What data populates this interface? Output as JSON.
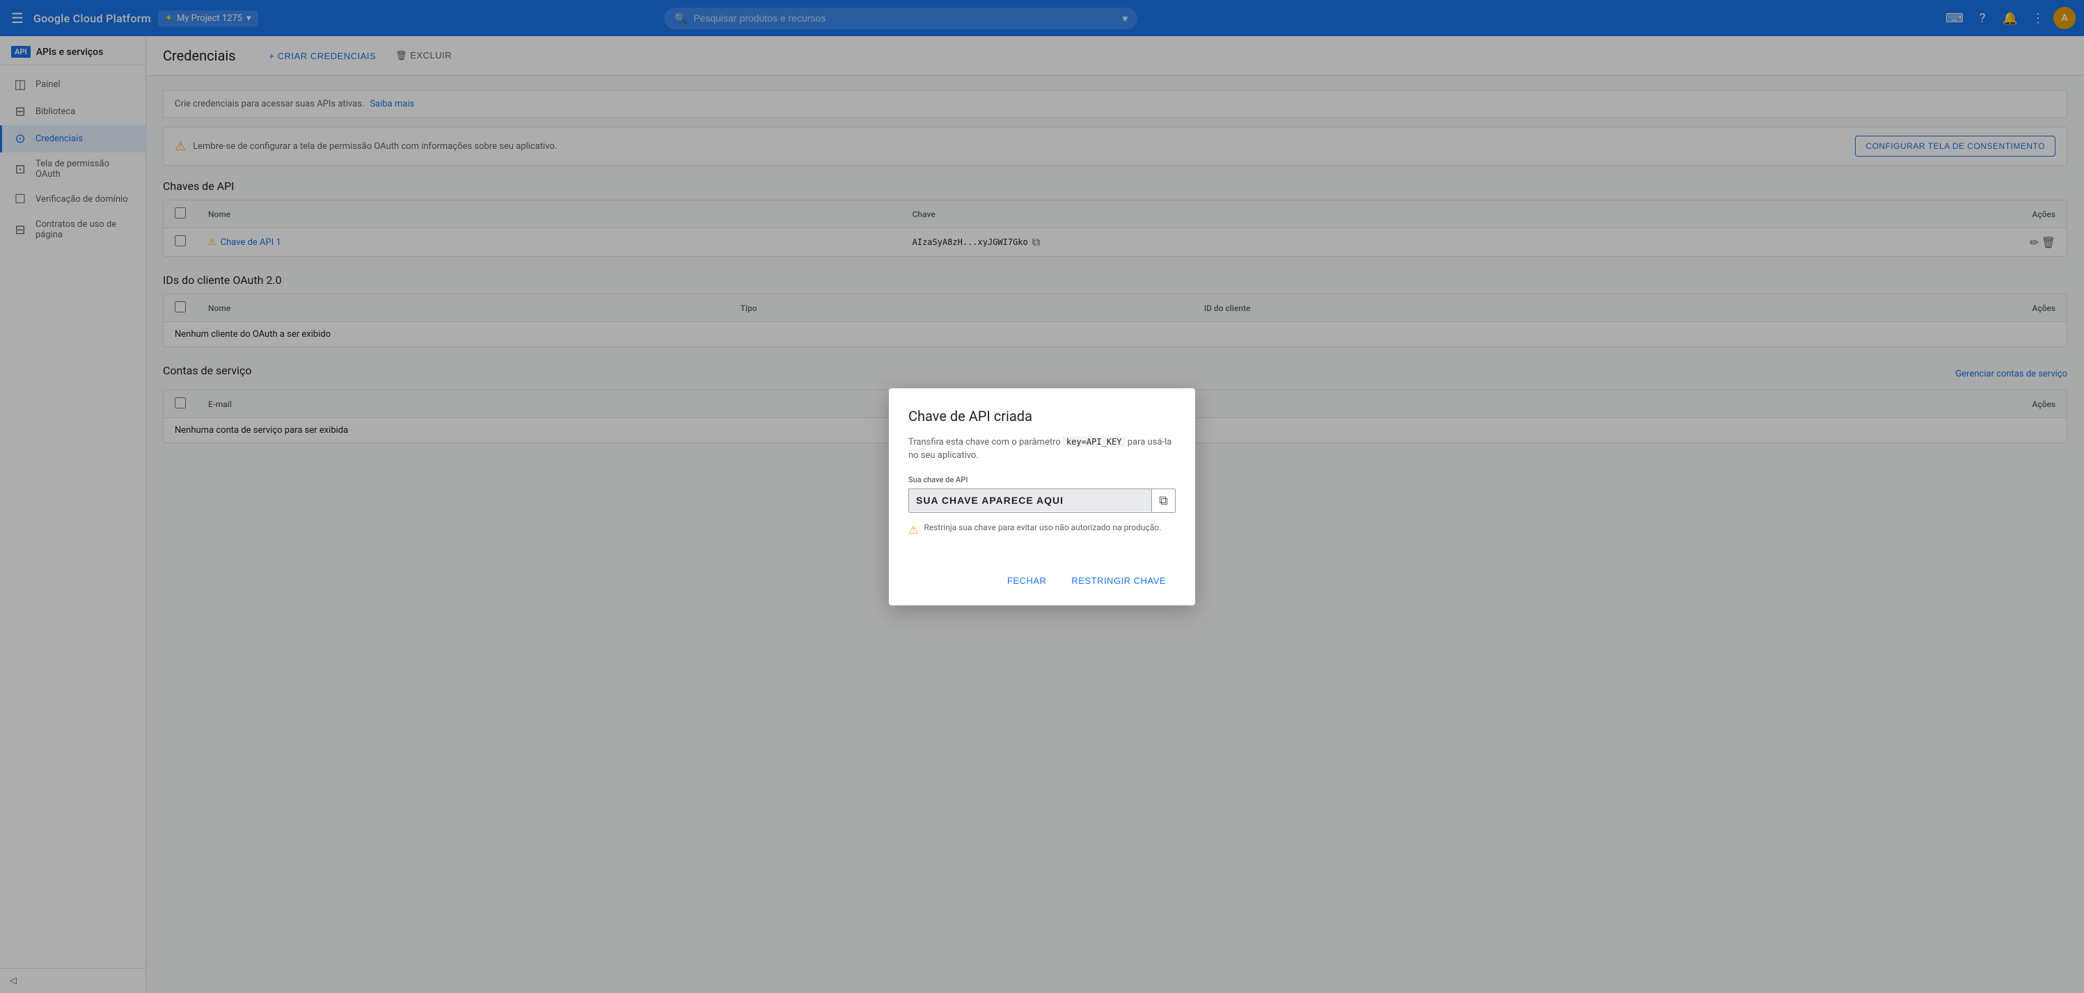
{
  "topNav": {
    "appName": "Google Cloud Platform",
    "project": "My Project 1275",
    "searchPlaceholder": "Pesquisar produtos e recursos",
    "hamburgerIcon": "☰",
    "dropdownIcon": "▾",
    "searchIconChar": "🔍",
    "icons": {
      "cloudShell": "⌨",
      "help": "?",
      "bell": "🔔",
      "dots": "⋮"
    },
    "avatarInitial": "A"
  },
  "sidebar": {
    "apiBadge": "API",
    "title": "APIs e serviços",
    "items": [
      {
        "id": "painel",
        "label": "Painel",
        "icon": "⊞",
        "active": false
      },
      {
        "id": "biblioteca",
        "label": "Biblioteca",
        "icon": "⊟",
        "active": false
      },
      {
        "id": "credenciais",
        "label": "Credenciais",
        "icon": "⊙",
        "active": true
      },
      {
        "id": "tela-permissao",
        "label": "Tela de permissão OAuth",
        "icon": "⊡",
        "active": false
      },
      {
        "id": "verificacao-dominio",
        "label": "Verificação de domínio",
        "icon": "☰",
        "active": false
      },
      {
        "id": "contratos-uso",
        "label": "Contratos de uso de página",
        "icon": "⊟",
        "active": false
      }
    ],
    "collapseIcon": "◁"
  },
  "page": {
    "title": "Credenciais",
    "createBtn": "+ CRIAR CREDENCIAIS",
    "deleteBtn": "🗑 EXCLUIR",
    "infoText": "Crie credenciais para acessar suas APIs ativas.",
    "infoLink": "Saiba mais",
    "warningText": "Lembre-se de configurar a tela de permissão OAuth com informações sobre seu aplicativo.",
    "warningIcon": "⚠",
    "consentBtn": "CONFIGURAR TELA DE CONSENTIMENTO",
    "sections": {
      "apiKeys": {
        "title": "Chaves de API",
        "columns": [
          "Nome",
          "Chave",
          "Ações"
        ],
        "rows": [
          {
            "name": "Chave de API 1",
            "key": "AIzaSyA8zH...xyJGWI7Gko",
            "hasWarning": true
          }
        ]
      },
      "oauthClients": {
        "title": "IDs do cliente OAuth 2.0",
        "columns": [
          "Nome",
          "Tipo",
          "ID do cliente",
          "Ações"
        ],
        "emptyText": "Nenhum cliente do OAuth a ser exibido"
      },
      "serviceAccounts": {
        "title": "Contas de serviço",
        "columns": [
          "E-mail",
          "Ações"
        ],
        "emptyText": "Nenhuma conta de serviço para ser exibida",
        "manageLink": "Gerenciar contas de serviço"
      }
    }
  },
  "modal": {
    "title": "Chave de API criada",
    "description": "Transfira esta chave com o parâmetro",
    "paramCode": "key=API_KEY",
    "descriptionEnd": "para usá-la no seu aplicativo.",
    "keyLabel": "Sua chave de API",
    "keyValue": "SUA CHAVE APARECE AQUI",
    "copyIcon": "⧉",
    "restrictWarning": "Restrinja sua chave para evitar uso não autorizado na produção.",
    "warningIcon": "⚠",
    "closeBtn": "FECHAR",
    "restrictBtn": "RESTRINGIR CHAVE"
  }
}
